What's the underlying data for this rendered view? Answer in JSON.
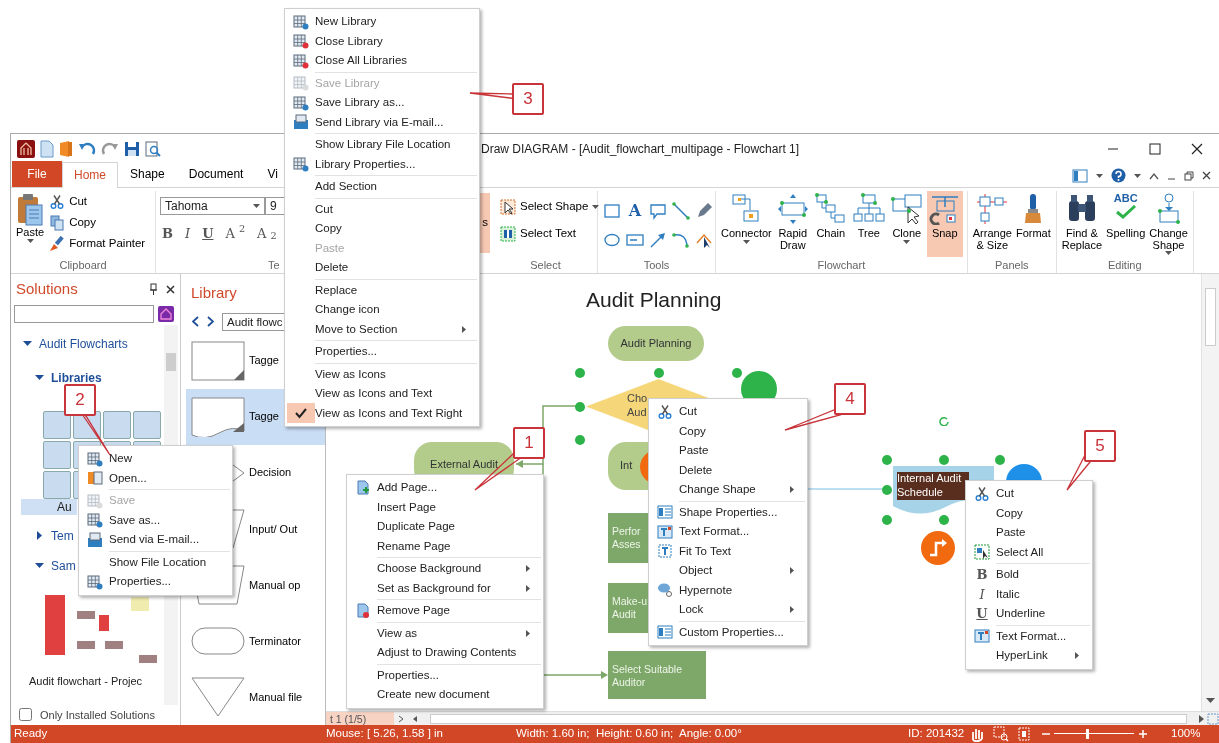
{
  "window": {
    "title": "Draw DIAGRAM - [Audit_flowchart_multipage - Flowchart 1]"
  },
  "tabs": [
    {
      "label": "File",
      "kind": "file",
      "selected": false
    },
    {
      "label": "Home",
      "kind": "tab",
      "selected": true
    },
    {
      "label": "Shape",
      "kind": "tab",
      "selected": false
    },
    {
      "label": "Document",
      "kind": "tab",
      "selected": false
    },
    {
      "label": "Vi",
      "kind": "tab",
      "selected": false
    }
  ],
  "ribbon": [
    {
      "kind": "clipboard",
      "label": "Clipboard",
      "paste": "Paste",
      "items": [
        "Cut",
        "Copy",
        "Format Painter"
      ]
    },
    {
      "kind": "text",
      "label": "Te",
      "font": "Tahoma",
      "size": "9",
      "format": [
        "B",
        "I",
        "U",
        "A$^{2}$",
        "A$_{2}$"
      ]
    },
    {
      "kind": "fragment",
      "text": "s"
    },
    {
      "kind": "select",
      "label": "Select",
      "items": [
        {
          "label": "Select Shape",
          "dropdown": true
        },
        {
          "label": "Select Text",
          "dropdown": false
        }
      ]
    },
    {
      "kind": "tools",
      "label": "Tools",
      "text_tool": "A"
    },
    {
      "kind": "large",
      "label": "Flowchart",
      "buttons": [
        {
          "label": "Connector",
          "dropdown": true,
          "on": false
        },
        {
          "label": "Rapid\nDraw",
          "dropdown": false,
          "on": false
        },
        {
          "label": "Chain",
          "dropdown": false,
          "on": false
        },
        {
          "label": "Tree",
          "dropdown": false,
          "on": false
        },
        {
          "label": "Clone",
          "dropdown": true,
          "on": false
        },
        {
          "label": "Snap",
          "dropdown": false,
          "on": true
        }
      ]
    },
    {
      "kind": "large",
      "label": "Panels",
      "buttons": [
        {
          "label": "Arrange\n& Size",
          "dropdown": false,
          "on": false
        },
        {
          "label": "Format",
          "dropdown": false,
          "on": false
        }
      ]
    },
    {
      "kind": "large",
      "label": "Editing",
      "buttons": [
        {
          "label": "Find &\nReplace",
          "dropdown": false,
          "on": false
        },
        {
          "label": "Spelling",
          "dropdown": false,
          "on": false,
          "art": "ABC"
        },
        {
          "label": "Change\nShape",
          "dropdown": true,
          "on": false
        }
      ]
    }
  ],
  "solutions": {
    "title": "Solutions",
    "tree": [
      {
        "label": "Audit Flowcharts",
        "expanded": true,
        "children": [
          {
            "label": "Libraries",
            "expanded": true,
            "libraries": [
              {
                "label": "Au",
                "selected": true
              }
            ]
          },
          {
            "label": "Tem",
            "expanded": false
          },
          {
            "label": "Sam",
            "expanded": true,
            "samples": [
              {
                "label": "Audit flowchart - Projec"
              }
            ]
          }
        ]
      }
    ],
    "only_installed": {
      "label": "Only Installed Solutions",
      "checked": false
    }
  },
  "library": {
    "title": "Library",
    "dropdown": "Audit flowc",
    "items": [
      {
        "label": "Tagge",
        "kind": "tagged-rect",
        "selected": false
      },
      {
        "label": "Tagge",
        "kind": "tagged-doc",
        "selected": true
      },
      {
        "label": "Decision",
        "kind": "decision",
        "selected": false
      },
      {
        "label": "Input/ Out",
        "kind": "data",
        "selected": false
      },
      {
        "label": "Manual op",
        "kind": "manual-op",
        "selected": false
      },
      {
        "label": "Terminator",
        "kind": "terminator",
        "selected": false
      },
      {
        "label": "Manual file",
        "kind": "manual-file",
        "selected": false
      }
    ]
  },
  "canvas": {
    "title": "Audit Planning",
    "page_tab": "t 1 (1/5)",
    "nodes": [
      {
        "kind": "terminal",
        "text": "Audit Planning",
        "selected": false
      },
      {
        "kind": "decision",
        "text": "Cho Aud",
        "selected": true
      },
      {
        "kind": "terminal",
        "text": "External Audit",
        "selected": false
      },
      {
        "kind": "terminal",
        "text": "Int",
        "selected": false
      },
      {
        "kind": "process",
        "text": "Perfor Asses",
        "selected": false
      },
      {
        "kind": "process",
        "text": "Make-u Audit",
        "selected": false
      },
      {
        "kind": "process",
        "text": "Select Suitable Auditor",
        "selected": false
      },
      {
        "kind": "document",
        "text": "Internal Audit Schedule",
        "selected": true
      }
    ]
  },
  "menus": {
    "library_menu": [
      [
        {
          "label": "New Library",
          "disabled": false,
          "submenu": false,
          "checked": false
        },
        {
          "label": "Close Library",
          "disabled": false,
          "submenu": false,
          "checked": false
        },
        {
          "label": "Close All Libraries",
          "disabled": false,
          "submenu": false,
          "checked": false
        }
      ],
      [
        {
          "label": "Save Library",
          "disabled": true,
          "submenu": false,
          "checked": false
        },
        {
          "label": "Save Library as...",
          "disabled": false,
          "submenu": false,
          "checked": false
        },
        {
          "label": "Send Library via E-mail...",
          "disabled": false,
          "submenu": false,
          "checked": false
        }
      ],
      [
        {
          "label": "Show Library File Location",
          "disabled": false,
          "submenu": false,
          "checked": false
        },
        {
          "label": "Library Properties...",
          "disabled": false,
          "submenu": false,
          "checked": false
        }
      ],
      [
        {
          "label": "Add Section",
          "disabled": false,
          "submenu": false,
          "checked": false
        }
      ],
      [
        {
          "label": "Cut",
          "disabled": false,
          "submenu": false,
          "checked": false
        },
        {
          "label": "Copy",
          "disabled": false,
          "submenu": false,
          "checked": false
        },
        {
          "label": "Paste",
          "disabled": true,
          "submenu": false,
          "checked": false
        },
        {
          "label": "Delete",
          "disabled": false,
          "submenu": false,
          "checked": false
        }
      ],
      [
        {
          "label": "Replace",
          "disabled": false,
          "submenu": false,
          "checked": false
        },
        {
          "label": "Change icon",
          "disabled": false,
          "submenu": false,
          "checked": false
        },
        {
          "label": "Move to Section",
          "disabled": false,
          "submenu": true,
          "checked": false
        }
      ],
      [
        {
          "label": "Properties...",
          "disabled": false,
          "submenu": false,
          "checked": false
        }
      ],
      [
        {
          "label": "View as Icons",
          "disabled": false,
          "submenu": false,
          "checked": false
        },
        {
          "label": "View as Icons and Text",
          "disabled": false,
          "submenu": false,
          "checked": false
        },
        {
          "label": "View as Icons and Text Right",
          "disabled": false,
          "submenu": false,
          "checked": true
        }
      ]
    ],
    "solutions_menu": [
      [
        {
          "label": "New",
          "disabled": false
        },
        {
          "label": "Open...",
          "disabled": false
        }
      ],
      [
        {
          "label": "Save",
          "disabled": true
        },
        {
          "label": "Save as...",
          "disabled": false
        },
        {
          "label": "Send via E-mail...",
          "disabled": false
        }
      ],
      [
        {
          "label": "Show File Location",
          "disabled": false
        },
        {
          "label": "Properties...",
          "disabled": false
        }
      ]
    ],
    "page_menu": [
      [
        {
          "label": "Add Page...",
          "submenu": false
        },
        {
          "label": "Insert Page",
          "submenu": false
        },
        {
          "label": "Duplicate Page",
          "submenu": false
        },
        {
          "label": "Rename Page",
          "submenu": false
        }
      ],
      [
        {
          "label": "Choose Background",
          "submenu": true
        },
        {
          "label": "Set as Background for",
          "submenu": true
        }
      ],
      [
        {
          "label": "Remove Page",
          "submenu": false
        }
      ],
      [
        {
          "label": "View as",
          "submenu": true
        },
        {
          "label": "Adjust to Drawing Contents",
          "submenu": false
        }
      ],
      [
        {
          "label": "Properties...",
          "submenu": false
        },
        {
          "label": "Create new document",
          "submenu": false
        }
      ]
    ],
    "shape_menu": [
      [
        {
          "label": "Cut",
          "submenu": false
        },
        {
          "label": "Copy",
          "submenu": false
        },
        {
          "label": "Paste",
          "submenu": false
        },
        {
          "label": "Delete",
          "submenu": false
        },
        {
          "label": "Change Shape",
          "submenu": true
        }
      ],
      [
        {
          "label": "Shape Properties...",
          "submenu": false
        },
        {
          "label": "Text Format...",
          "submenu": false
        },
        {
          "label": "Fit To Text",
          "submenu": false
        },
        {
          "label": "Object",
          "submenu": true
        },
        {
          "label": "Hypernote",
          "submenu": false
        },
        {
          "label": "Lock",
          "submenu": true
        }
      ],
      [
        {
          "label": "Custom Properties...",
          "submenu": false
        }
      ]
    ],
    "text_menu": [
      [
        {
          "label": "Cut",
          "submenu": false
        },
        {
          "label": "Copy",
          "submenu": false
        },
        {
          "label": "Paste",
          "submenu": false
        },
        {
          "label": "Select All",
          "submenu": false
        }
      ],
      [
        {
          "label": "Bold",
          "submenu": false,
          "glyph": "B"
        },
        {
          "label": "Italic",
          "submenu": false,
          "glyph": "I"
        },
        {
          "label": "Underline",
          "submenu": false,
          "glyph": "U"
        }
      ],
      [
        {
          "label": "Text Format...",
          "submenu": false
        },
        {
          "label": "HyperLink",
          "submenu": true
        }
      ]
    ]
  },
  "callouts": [
    "3",
    "2",
    "1",
    "4",
    "5"
  ],
  "status_bar": {
    "ready": "Ready",
    "mouse": "Mouse: [ 5.26, 1.58 ] in",
    "size": "Width: 1.60 in;  Height: 0.60 in;  Angle: 0.00°",
    "id": "ID: 201432",
    "zoom": {
      "level": 0.42,
      "reading": "100%"
    }
  }
}
